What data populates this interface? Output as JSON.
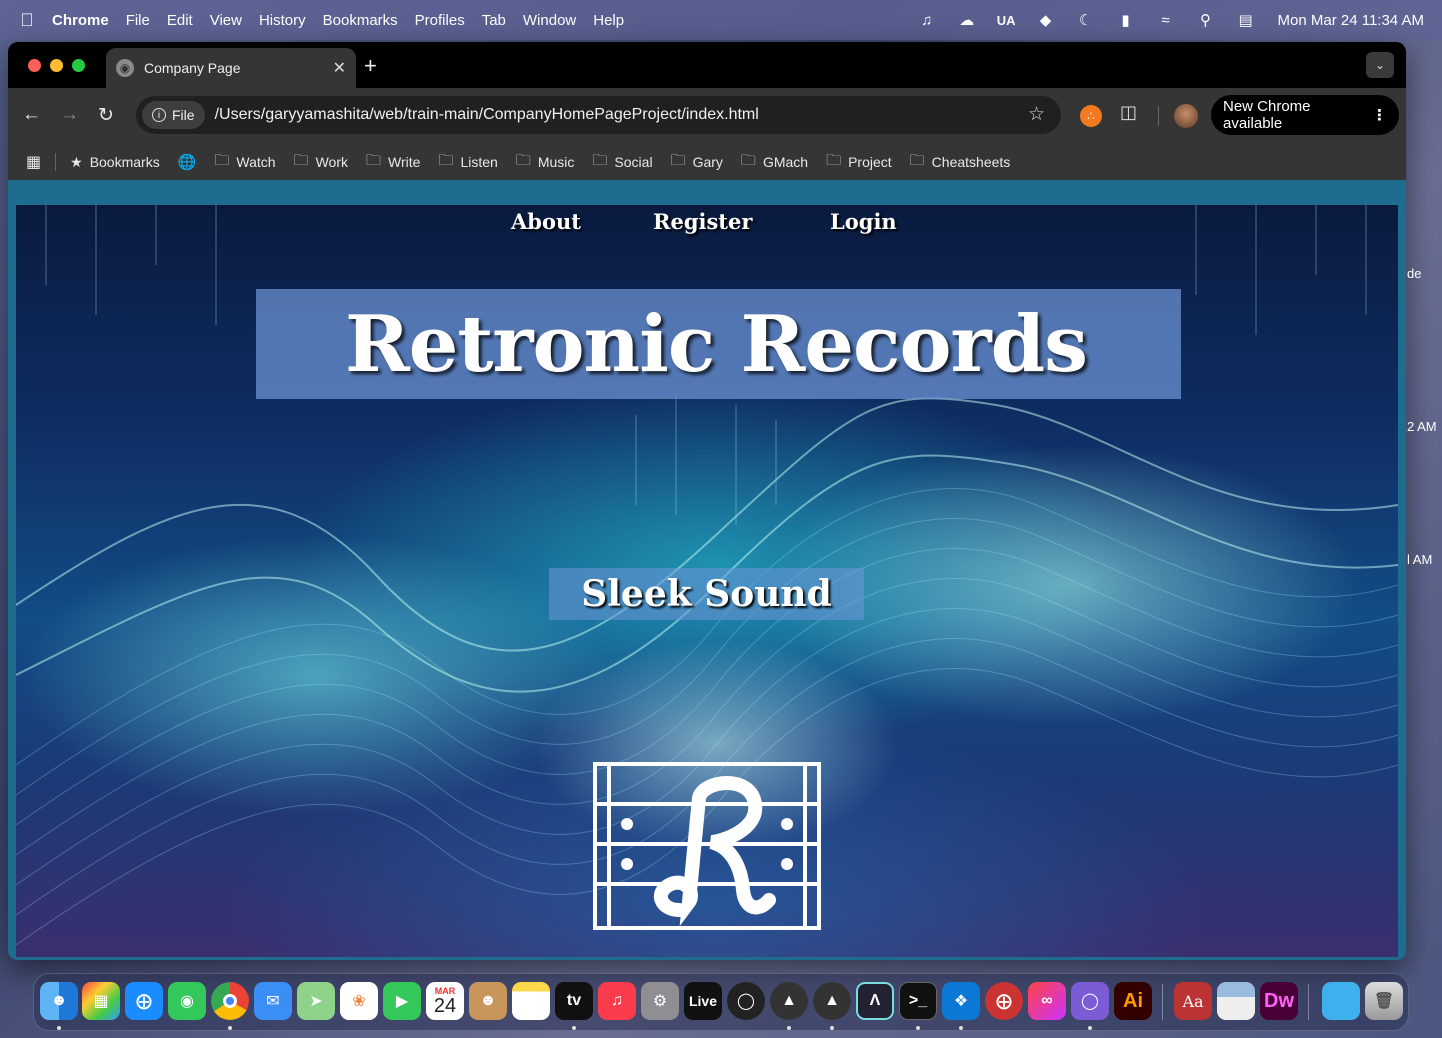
{
  "menubar": {
    "items": [
      "Chrome",
      "File",
      "Edit",
      "View",
      "History",
      "Bookmarks",
      "Profiles",
      "Tab",
      "Window",
      "Help"
    ],
    "status": {
      "input_source": "UA",
      "clock": "Mon Mar 24  11:34 AM"
    }
  },
  "browser": {
    "tab_title": "Company Page",
    "omnibox_chip": "File",
    "url": "/Users/garyyamashita/web/train-main/CompanyHomePageProject/index.html",
    "update_button": "New Chrome available",
    "bookmarks": [
      "Bookmarks",
      "Watch",
      "Work",
      "Write",
      "Listen",
      "Music",
      "Social",
      "Gary",
      "GMach",
      "Project",
      "Cheatsheets"
    ]
  },
  "page": {
    "nav": [
      "About",
      "Register",
      "Login"
    ],
    "brand": "Retronic Records",
    "tagline": "Sleek Sound"
  },
  "desktop_edge": [
    "de",
    "2 AM",
    "l AM"
  ],
  "dock": {
    "calendar_month": "MAR",
    "calendar_day": "24",
    "apps": [
      "finder-icon",
      "launchpad-icon",
      "safari-icon",
      "messages-icon",
      "chrome-icon",
      "mail-icon",
      "maps-icon",
      "photos-icon",
      "facetime-icon",
      "calendar-icon",
      "contacts-icon",
      "notes-icon",
      "appletv-icon",
      "music-icon",
      "system-settings-icon",
      "ableton-live-icon",
      "obs-icon",
      "ua-connect-icon",
      "ua-console-icon",
      "logic-icon",
      "terminal-icon",
      "vscode-icon",
      "safari-dev-icon",
      "creative-cloud-icon",
      "github-icon",
      "illustrator-icon",
      "dictionary-icon",
      "preview-icon",
      "dreamweaver-icon",
      "folder-icon",
      "trash-icon"
    ],
    "labels": {
      "appletv": "tv",
      "live": "Live",
      "illustrator": "Ai",
      "dictionary": "Aa",
      "dreamweaver": "Dw"
    }
  },
  "colors": {
    "window_bg": "#1f6d8e",
    "chrome_dark": "#353535",
    "brand_box": "#6e96d7"
  }
}
